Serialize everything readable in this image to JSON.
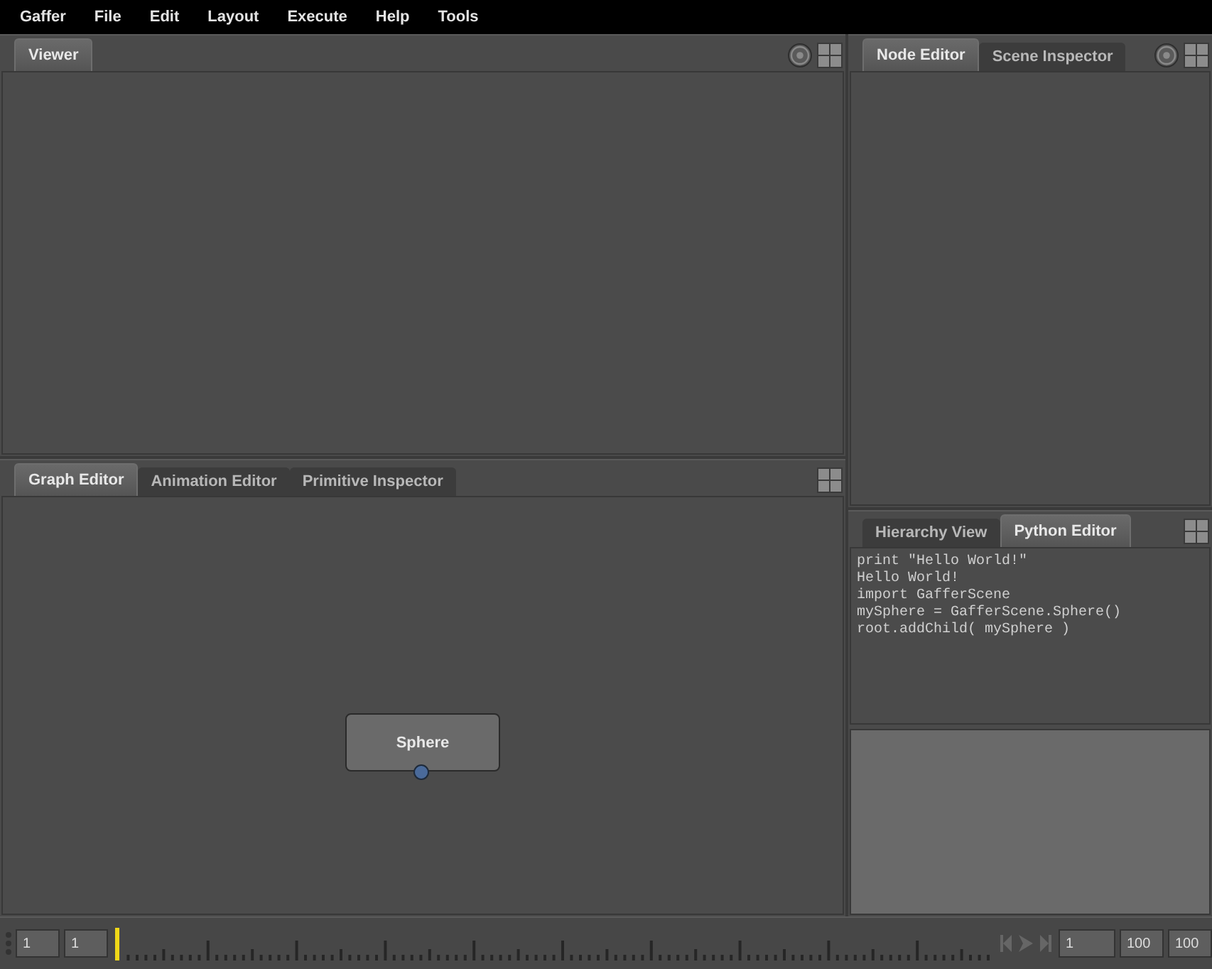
{
  "menu": [
    "Gaffer",
    "File",
    "Edit",
    "Layout",
    "Execute",
    "Help",
    "Tools"
  ],
  "left_column": [
    {
      "tabs": [
        {
          "label": "Viewer",
          "selected": true
        }
      ],
      "header_icons": [
        {
          "kind": "target"
        },
        {
          "kind": "layout"
        }
      ],
      "content": {
        "kind": "empty"
      }
    },
    {
      "tabs": [
        {
          "label": "Graph Editor",
          "selected": true
        },
        {
          "label": "Animation Editor",
          "selected": false
        },
        {
          "label": "Primitive Inspector",
          "selected": false
        }
      ],
      "header_icons": [
        {
          "kind": "layout"
        }
      ],
      "content": {
        "kind": "graph",
        "nodes": [
          {
            "label": "Sphere"
          }
        ]
      }
    }
  ],
  "right_column": [
    {
      "tabs": [
        {
          "label": "Node Editor",
          "selected": true
        },
        {
          "label": "Scene Inspector",
          "selected": false
        }
      ],
      "header_icons": [
        {
          "kind": "target"
        },
        {
          "kind": "layout"
        }
      ],
      "content": {
        "kind": "empty"
      }
    },
    {
      "tabs": [
        {
          "label": "Hierarchy View",
          "selected": false
        },
        {
          "label": "Python Editor",
          "selected": true
        }
      ],
      "header_icons": [
        {
          "kind": "layout"
        }
      ],
      "content": {
        "kind": "python",
        "output": [
          "print \"Hello World!\"",
          "Hello World!",
          "import GafferScene",
          "mySphere = GafferScene.Sphere()",
          "root.addChild( mySphere )"
        ]
      }
    }
  ],
  "timeline": {
    "start": "1",
    "current": "1",
    "frame": "1",
    "end": "100",
    "range_end": "100"
  }
}
